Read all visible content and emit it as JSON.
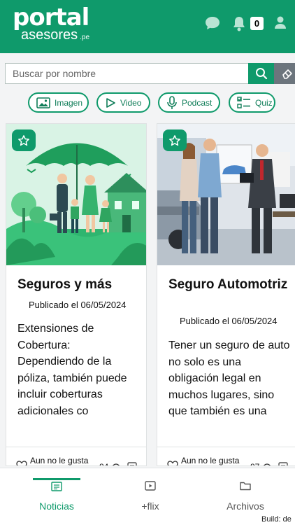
{
  "header": {
    "logo_top": "portal",
    "logo_bottom": "asesores",
    "logo_suffix": ".pe",
    "notification_count": "0",
    "icons": [
      "chat-icon",
      "bell-icon",
      "user-icon"
    ]
  },
  "search": {
    "placeholder": "Buscar por nombre",
    "value": ""
  },
  "filters": [
    {
      "label": "Imagen",
      "icon": "image-icon"
    },
    {
      "label": "Video",
      "icon": "play-icon"
    },
    {
      "label": "Podcast",
      "icon": "microphone-icon"
    },
    {
      "label": "Quiz",
      "icon": "checklist-icon"
    }
  ],
  "cards": [
    {
      "title": "Seguros y más",
      "date": "Publicado el 06/05/2024",
      "excerpt": "Extensiones de Cobertura: Dependiendo de la póliza, también puede incluir coberturas adicionales co",
      "likes_text": "Aun no le gusta",
      "views": "84"
    },
    {
      "title": "Seguro Automotriz",
      "date": "Publicado el 06/05/2024",
      "excerpt": "Tener un seguro de auto no solo es una obligación legal en muchos lugares, sino que también es una",
      "likes_text": "Aun no le gusta",
      "views": "87"
    }
  ],
  "nav": [
    {
      "label": "Noticias",
      "active": true
    },
    {
      "label": "+flix",
      "active": false
    },
    {
      "label": "Archivos",
      "active": false
    }
  ],
  "build": "Build: de",
  "colors": {
    "brand": "#0f9a6b",
    "erase": "#6c757d"
  }
}
